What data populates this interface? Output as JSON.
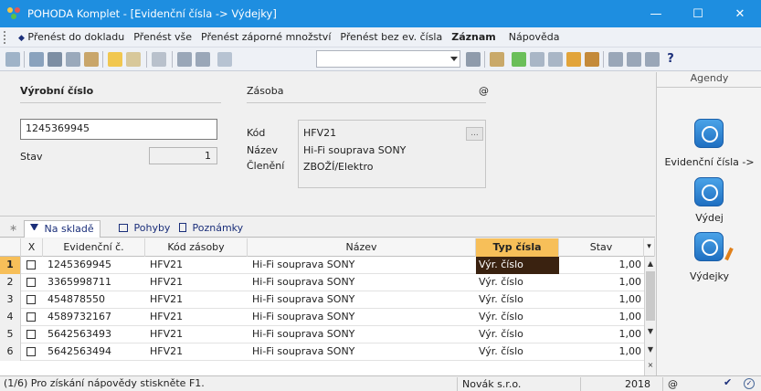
{
  "window": {
    "title": "POHODA Komplet - [Evidenční čísla -> Výdejky]",
    "minimize": "—",
    "maximize": "☐",
    "close": "✕"
  },
  "menu": {
    "items": [
      {
        "label": "Přenést do dokladu",
        "arrow": "◆"
      },
      {
        "label": "Přenést vše"
      },
      {
        "label": "Přenést záporné množství"
      },
      {
        "label": "Přenést bez ev. čísla"
      },
      {
        "label": "Záznam"
      },
      {
        "label": "Nápověda"
      }
    ]
  },
  "toolbar": {
    "combo_value": "",
    "icons": [
      "back-icon",
      "copy-icon",
      "print-icon",
      "preview-icon",
      "export-icon",
      "new-icon",
      "edit-icon",
      "delete-icon",
      "save-icon",
      "save-all-icon",
      "paste-icon",
      "filter-icon",
      "calc-icon",
      "settings-icon",
      "bank-icon",
      "help-icon"
    ],
    "help_glyph": "?"
  },
  "form": {
    "vyrobni_cislo_label": "Výrobní číslo",
    "vyrobni_cislo_value": "1245369945",
    "stav_label": "Stav",
    "stav_value": "1",
    "zasoba_label": "Zásoba",
    "at_sign": "@",
    "kod_label": "Kód",
    "kod_value": "HFV21",
    "nazev_label": "Název",
    "nazev_value": "Hi-Fi souprava SONY",
    "cleneni_label": "Členění",
    "cleneni_value": "ZBOŽÍ/Elektro",
    "ellipsis": "..."
  },
  "tabs": {
    "star": "∗",
    "items": [
      {
        "label": "Na skladě"
      },
      {
        "label": "Pohyby"
      },
      {
        "label": "Poznámky"
      }
    ]
  },
  "grid": {
    "headers": {
      "x": "X",
      "evidencni": "Evidenční č.",
      "kod": "Kód zásoby",
      "nazev": "Název",
      "typ": "Typ čísla",
      "stav": "Stav"
    },
    "rows": [
      {
        "n": "1",
        "ev": "1245369945",
        "kod": "HFV21",
        "nazev": "Hi-Fi souprava SONY",
        "typ": "Výr. číslo",
        "stav": "1,00"
      },
      {
        "n": "2",
        "ev": "3365998711",
        "kod": "HFV21",
        "nazev": "Hi-Fi souprava SONY",
        "typ": "Výr. číslo",
        "stav": "1,00"
      },
      {
        "n": "3",
        "ev": "454878550",
        "kod": "HFV21",
        "nazev": "Hi-Fi souprava SONY",
        "typ": "Výr. číslo",
        "stav": "1,00"
      },
      {
        "n": "4",
        "ev": "4589732167",
        "kod": "HFV21",
        "nazev": "Hi-Fi souprava SONY",
        "typ": "Výr. číslo",
        "stav": "1,00"
      },
      {
        "n": "5",
        "ev": "5642563493",
        "kod": "HFV21",
        "nazev": "Hi-Fi souprava SONY",
        "typ": "Výr. číslo",
        "stav": "1,00"
      },
      {
        "n": "6",
        "ev": "5642563494",
        "kod": "HFV21",
        "nazev": "Hi-Fi souprava SONY",
        "typ": "Výr. číslo",
        "stav": "1,00"
      }
    ]
  },
  "agendy": {
    "title": "Agendy",
    "items": [
      {
        "label": "Evidenční čísla ->"
      },
      {
        "label": "Výdej"
      },
      {
        "label": "Výdejky"
      }
    ]
  },
  "status": {
    "help_text": "(1/6) Pro získání nápovědy stiskněte F1.",
    "company": "Novák s.r.o.",
    "year": "2018",
    "at_sign": "@"
  },
  "colors": {
    "titlebar": "#1e8ee0",
    "selected_header": "#f7bf59",
    "current_cell": "#3a2210"
  }
}
